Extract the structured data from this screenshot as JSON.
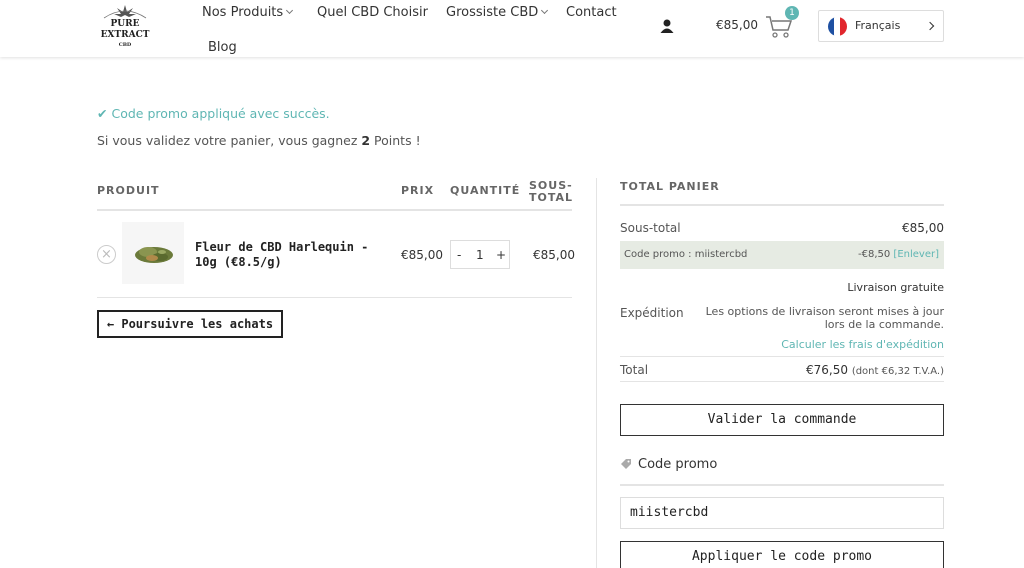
{
  "header": {
    "logo_text": "PURE EXTRACT CBD",
    "nav": {
      "products": "Nos Produits",
      "choose": "Quel CBD Choisir",
      "wholesale": "Grossiste CBD",
      "contact": "Contact",
      "blog": "Blog"
    },
    "cart_total": "€85,00",
    "cart_count": "1",
    "language": "Français"
  },
  "notices": {
    "success": "Code promo appliqué avec succès.",
    "points_before": "Si vous validez votre panier, vous gagnez ",
    "points_value": "2",
    "points_after": " Points !"
  },
  "cart": {
    "headers": {
      "product": "PRODUIT",
      "price": "PRIX",
      "quantity": "QUANTITÉ",
      "subtotal_line1": "SOUS-",
      "subtotal_line2": "TOTAL"
    },
    "item": {
      "name": "Fleur de CBD Harlequin - 10g (€8.5/g)",
      "price": "€85,00",
      "quantity": "1",
      "subtotal": "€85,00"
    },
    "continue_label": "← Poursuivre les achats"
  },
  "totals": {
    "title": "TOTAL PANIER",
    "subtotal_label": "Sous-total",
    "subtotal_value": "€85,00",
    "promo_label": "Code promo : miistercbd",
    "promo_value": "-€8,50",
    "promo_remove": "[Enlever]",
    "shipping_label": "Expédition",
    "shipping_free": "Livraison gratuite",
    "shipping_note": "Les options de livraison seront mises à jour lors de la commande.",
    "shipping_calc": "Calculer les frais d'expédition",
    "total_label": "Total",
    "total_value": "€76,50",
    "total_tax": "(dont €6,32 T.V.A.)",
    "checkout_label": "Valider la commande",
    "promo_title": "Code promo",
    "promo_input_value": "miistercbd",
    "apply_label": "Appliquer le code promo"
  },
  "colors": {
    "accent": "#5fb6b3",
    "promo_bg": "#e6ebe3"
  },
  "icons": {
    "check": "check-icon",
    "user": "user-icon",
    "cart": "cart-icon",
    "flag": "france-flag-icon",
    "tag": "tag-icon",
    "remove": "close-circle-icon"
  }
}
